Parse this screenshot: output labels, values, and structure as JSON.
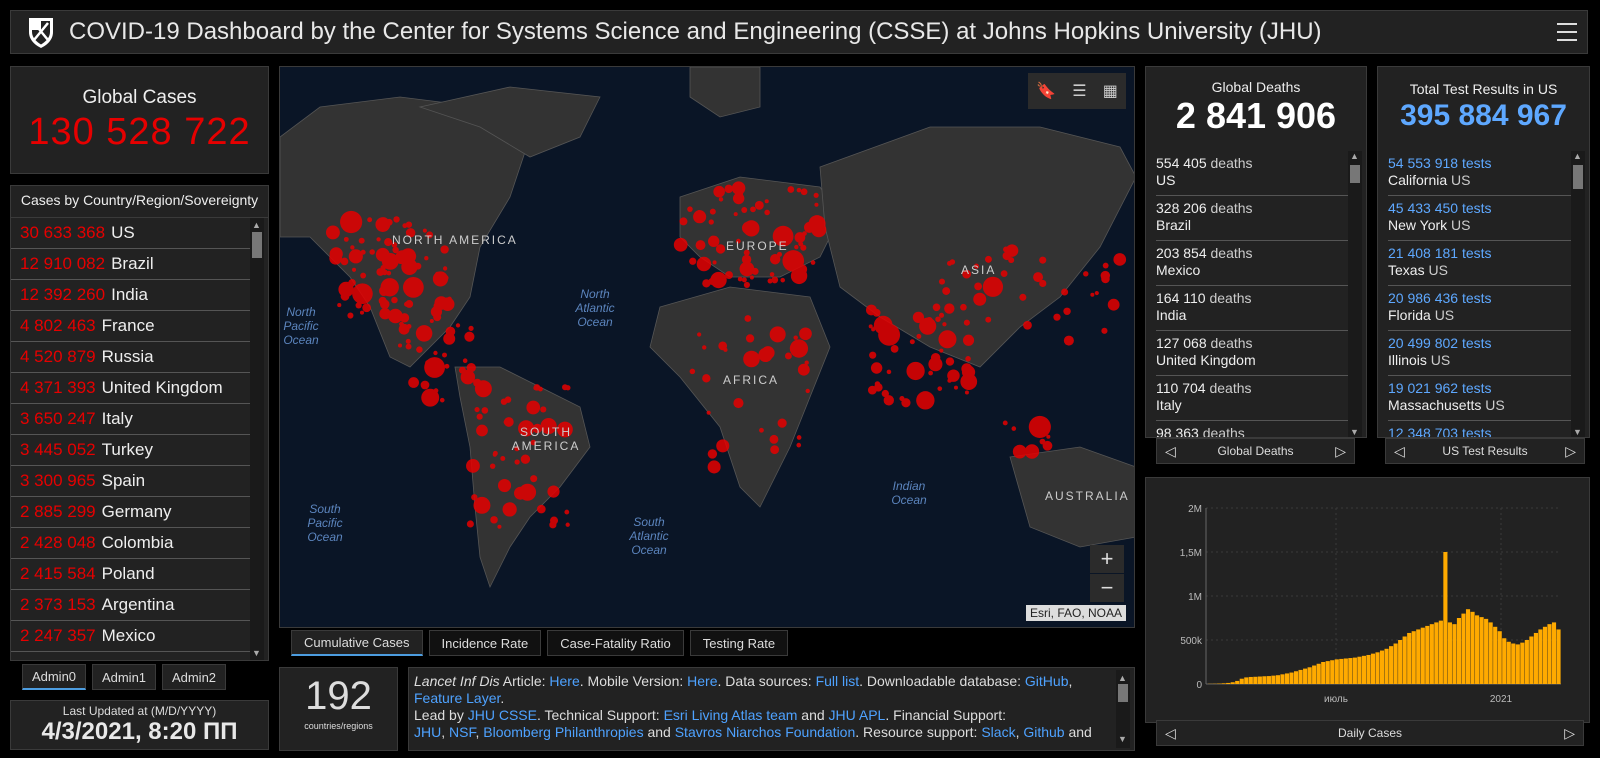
{
  "header": {
    "title": "COVID-19 Dashboard by the Center for Systems Science and Engineering (CSSE) at Johns Hopkins University (JHU)"
  },
  "global_cases": {
    "label": "Global Cases",
    "value": "130 528 722"
  },
  "country_list": {
    "header": "Cases by Country/Region/Sovereignty",
    "rows": [
      {
        "count": "30 633 368",
        "country": "US"
      },
      {
        "count": "12 910 082",
        "country": "Brazil"
      },
      {
        "count": "12 392 260",
        "country": "India"
      },
      {
        "count": "4 802 463",
        "country": "France"
      },
      {
        "count": "4 520 879",
        "country": "Russia"
      },
      {
        "count": "4 371 393",
        "country": "United Kingdom"
      },
      {
        "count": "3 650 247",
        "country": "Italy"
      },
      {
        "count": "3 445 052",
        "country": "Turkey"
      },
      {
        "count": "3 300 965",
        "country": "Spain"
      },
      {
        "count": "2 885 299",
        "country": "Germany"
      },
      {
        "count": "2 428 048",
        "country": "Colombia"
      },
      {
        "count": "2 415 584",
        "country": "Poland"
      },
      {
        "count": "2 373 153",
        "country": "Argentina"
      },
      {
        "count": "2 247 357",
        "country": "Mexico"
      }
    ]
  },
  "admin_tabs": [
    "Admin0",
    "Admin1",
    "Admin2"
  ],
  "last_updated": {
    "label": "Last Updated at (M/D/YYYY)",
    "value": "4/3/2021, 8:20 ПП"
  },
  "map": {
    "continents": {
      "north_america": "NORTH AMERICA",
      "south_america": "SOUTH AMERICA",
      "europe": "EUROPE",
      "africa": "AFRICA",
      "asia": "ASIA",
      "australia": "AUSTRALIA"
    },
    "oceans": {
      "north_pacific": "North Pacific Ocean",
      "north_atlantic": "North Atlantic Ocean",
      "south_pacific": "South Pacific Ocean",
      "south_atlantic": "South Atlantic Ocean",
      "indian": "Indian Ocean"
    },
    "attribution": "Esri, FAO, NOAA",
    "zoom_in": "+",
    "zoom_out": "−"
  },
  "map_tabs": [
    "Cumulative Cases",
    "Incidence Rate",
    "Case-Fatality Ratio",
    "Testing Rate"
  ],
  "countries_count": {
    "value": "192",
    "label": "countries/regions"
  },
  "info": {
    "journal": "Lancet Inf Dis",
    "t1": " Article: ",
    "here1": "Here",
    "t2": ". Mobile Version: ",
    "here2": "Here",
    "t3": ". Data sources: ",
    "full_list": "Full list",
    "t4": ". Downloadable database: ",
    "github": "GitHub",
    "t5": ", ",
    "feature_layer": "Feature Layer",
    "t6": ".",
    "t7": "Lead by ",
    "jhu_csse": "JHU CSSE",
    "t8": ". Technical Support: ",
    "esri": "Esri Living Atlas team",
    "t9": " and ",
    "jhu_apl": "JHU APL",
    "t10": ". Financial Support:",
    "jhu": "JHU",
    "nsf": "NSF",
    "bloomberg": "Bloomberg Philanthropies",
    "t11": " and ",
    "stavros": "Stavros Niarchos Foundation",
    "t12": ". Resource support: ",
    "slack": "Slack",
    "github2": "Github",
    "t13": " and"
  },
  "deaths": {
    "label": "Global Deaths",
    "value": "2 841 906",
    "unit": "deaths",
    "rows": [
      {
        "count": "554 405",
        "place": "US"
      },
      {
        "count": "328 206",
        "place": "Brazil"
      },
      {
        "count": "203 854",
        "place": "Mexico"
      },
      {
        "count": "164 110",
        "place": "India"
      },
      {
        "count": "127 068",
        "place": "United Kingdom"
      },
      {
        "count": "110 704",
        "place": "Italy"
      },
      {
        "count": "98 363",
        "place": ""
      }
    ],
    "nav_label": "Global Deaths"
  },
  "tests": {
    "label": "Total Test Results in US",
    "value": "395 884 967",
    "unit": "tests",
    "rows": [
      {
        "count": "54 553 918",
        "state": "California",
        "country": "US"
      },
      {
        "count": "45 433 450",
        "state": "New York",
        "country": "US"
      },
      {
        "count": "21 408 181",
        "state": "Texas",
        "country": "US"
      },
      {
        "count": "20 986 436",
        "state": "Florida",
        "country": "US"
      },
      {
        "count": "20 499 802",
        "state": "Illinois",
        "country": "US"
      },
      {
        "count": "19 021 962",
        "state": "Massachusetts",
        "country": "US"
      },
      {
        "count": "12 348 703",
        "state": "",
        "country": ""
      }
    ],
    "nav_label": "US Test Results"
  },
  "chart_data": {
    "type": "bar",
    "title": "",
    "xlabel": "",
    "ylabel": "",
    "ylim": [
      0,
      2000000
    ],
    "y_ticks": [
      {
        "v": 0,
        "label": "0"
      },
      {
        "v": 500000,
        "label": "500k"
      },
      {
        "v": 1000000,
        "label": "1M"
      },
      {
        "v": 1500000,
        "label": "1,5M"
      },
      {
        "v": 2000000,
        "label": "2M"
      }
    ],
    "x_ticks": [
      "июль",
      "2021"
    ],
    "color": "#ffaa00",
    "series": [
      {
        "name": "Daily Cases",
        "values": [
          2000,
          3000,
          5000,
          8000,
          12000,
          20000,
          35000,
          60000,
          75000,
          80000,
          82000,
          85000,
          88000,
          90000,
          95000,
          100000,
          110000,
          120000,
          130000,
          145000,
          160000,
          175000,
          190000,
          210000,
          230000,
          250000,
          260000,
          270000,
          280000,
          285000,
          290000,
          295000,
          300000,
          310000,
          320000,
          330000,
          345000,
          360000,
          380000,
          400000,
          430000,
          460000,
          500000,
          540000,
          580000,
          600000,
          620000,
          640000,
          660000,
          680000,
          700000,
          720000,
          1500000,
          700000,
          680000,
          750000,
          800000,
          850000,
          820000,
          780000,
          760000,
          740000,
          700000,
          650000,
          600000,
          520000,
          480000,
          460000,
          450000,
          470000,
          500000,
          540000,
          580000,
          620000,
          650000,
          680000,
          700000,
          620000
        ]
      }
    ]
  },
  "chart_nav_label": "Daily Cases"
}
